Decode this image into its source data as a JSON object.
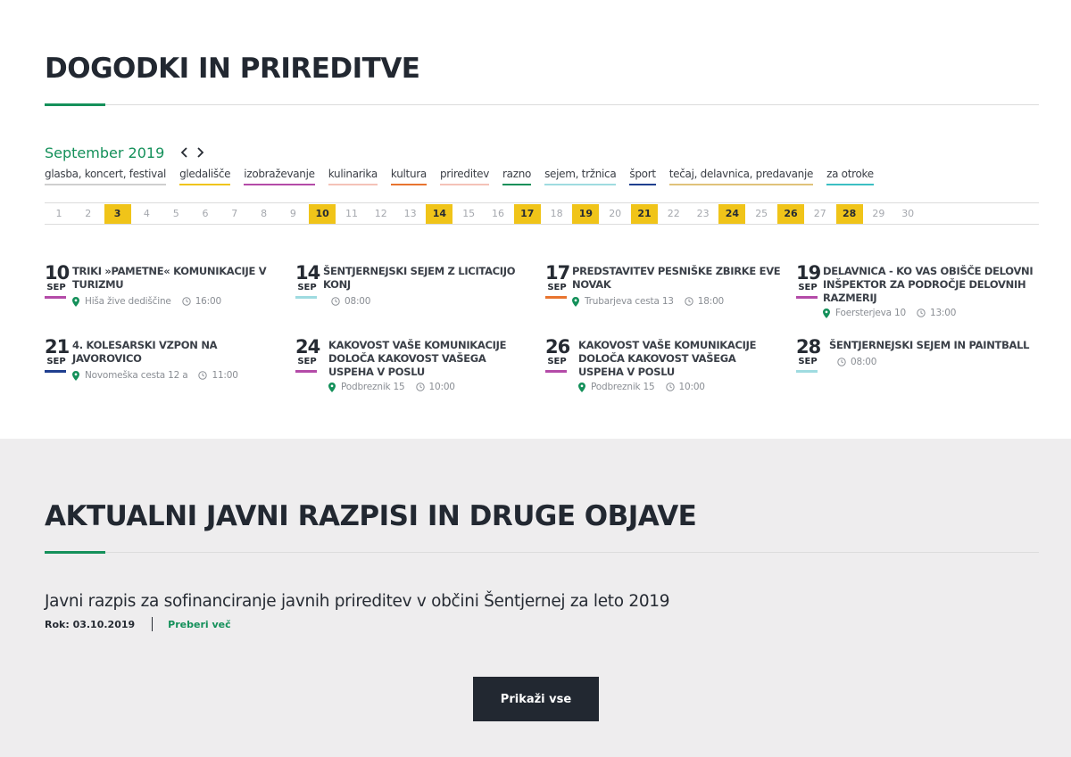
{
  "events_section": {
    "heading": "DOGODKI IN PRIREDITVE",
    "month_label": "September 2019",
    "categories": [
      {
        "label": "glasba, koncert, festival",
        "color": "#cfcfcf"
      },
      {
        "label": "gledališče",
        "color": "#f0c419"
      },
      {
        "label": "izobraževanje",
        "color": "#b44ba8"
      },
      {
        "label": "kulinarika",
        "color": "#f4c2b8"
      },
      {
        "label": "kultura",
        "color": "#e8742f"
      },
      {
        "label": "prireditev",
        "color": "#f4c2b8"
      },
      {
        "label": "razno",
        "color": "#14905a"
      },
      {
        "label": "sejem, tržnica",
        "color": "#9fdbe0"
      },
      {
        "label": "šport",
        "color": "#1f3f8f"
      },
      {
        "label": "tečaj, delavnica, predavanje",
        "color": "#e0c27a"
      },
      {
        "label": "za otroke",
        "color": "#3cbfc3"
      }
    ],
    "days": [
      "1",
      "2",
      "3",
      "4",
      "5",
      "6",
      "7",
      "8",
      "9",
      "10",
      "11",
      "12",
      "13",
      "14",
      "15",
      "16",
      "17",
      "18",
      "19",
      "20",
      "21",
      "22",
      "23",
      "24",
      "25",
      "26",
      "27",
      "28",
      "29",
      "30"
    ],
    "event_days": [
      "3",
      "10",
      "14",
      "17",
      "19",
      "21",
      "24",
      "26",
      "28"
    ],
    "events": [
      {
        "day": "10",
        "month": "SEP",
        "title": "TRIKI »PAMETNE« KOMUNIKACIJE V TURIZMU",
        "location": "Hiša žive dediščine",
        "time": "16:00",
        "color": "#b44ba8"
      },
      {
        "day": "14",
        "month": "SEP",
        "title": "ŠENTJERNEJSKI SEJEM Z LICITACIJO KONJ",
        "location": "",
        "time": "08:00",
        "color": "#9fdbe0"
      },
      {
        "day": "17",
        "month": "SEP",
        "title": "PREDSTAVITEV PESNIŠKE ZBIRKE EVE NOVAK",
        "location": "Trubarjeva cesta 13",
        "time": "18:00",
        "color": "#e8742f"
      },
      {
        "day": "19",
        "month": "SEP",
        "title": "DELAVNICA - KO VAS OBIŠČE DELOVNI INŠPEKTOR ZA PODROČJE DELOVNIH RAZMERIJ",
        "location": "Foersterjeva 10",
        "time": "13:00",
        "color": "#b44ba8"
      },
      {
        "day": "21",
        "month": "SEP",
        "title": "4. KOLESARSKI VZPON NA JAVOROVICO",
        "location": "Novomeška cesta 12 a",
        "time": "11:00",
        "color": "#1f3f8f"
      },
      {
        "day": "24",
        "month": "SEP",
        "title": "KAKOVOST VAŠE KOMUNIKACIJE DOLOČA KAKOVOST VAŠEGA USPEHA V POSLU",
        "location": "Podbreznik 15",
        "time": "10:00",
        "color": "#b44ba8"
      },
      {
        "day": "26",
        "month": "SEP",
        "title": "KAKOVOST VAŠE KOMUNIKACIJE DOLOČA KAKOVOST VAŠEGA USPEHA V POSLU",
        "location": "Podbreznik 15",
        "time": "10:00",
        "color": "#b44ba8"
      },
      {
        "day": "28",
        "month": "SEP",
        "title": "ŠENTJERNEJSKI SEJEM IN PAINTBALL",
        "location": "",
        "time": "08:00",
        "color": "#9fdbe0"
      }
    ]
  },
  "notices_section": {
    "heading": "AKTUALNI JAVNI RAZPISI IN DRUGE OBJAVE",
    "notice": {
      "title": "Javni razpis za sofinanciranje javnih prireditev v občini Šentjernej za leto 2019",
      "deadline": "Rok: 03.10.2019",
      "read_more": "Preberi več"
    },
    "show_all_label": "Prikaži vse"
  },
  "colors": {
    "accent_green": "#14905a",
    "highlight_yellow": "#f0c419",
    "dark": "#222831",
    "section_bg": "#eeedee"
  },
  "icons": {
    "prev": "chevron-left-icon",
    "next": "chevron-right-icon",
    "location": "map-pin-icon",
    "time": "clock-icon"
  }
}
